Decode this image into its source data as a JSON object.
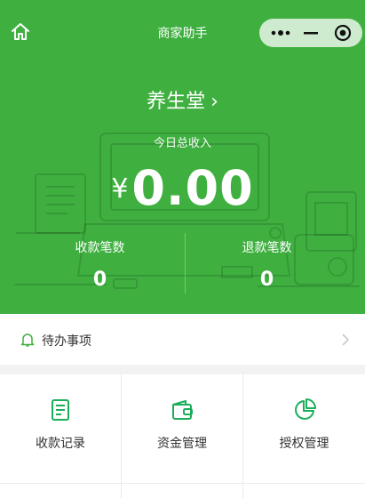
{
  "app": {
    "title": "商家助手"
  },
  "store": {
    "name": "养生堂",
    "chevron": "›"
  },
  "revenue": {
    "label": "今日总收入",
    "currency": "¥",
    "amount": "0.00"
  },
  "stats": [
    {
      "label": "收款笔数",
      "value": "0"
    },
    {
      "label": "退款笔数",
      "value": "0"
    }
  ],
  "todo": {
    "label": "待办事项"
  },
  "menu": [
    {
      "label": "收款记录",
      "icon": "receipt-icon"
    },
    {
      "label": "资金管理",
      "icon": "wallet-icon"
    },
    {
      "label": "授权管理",
      "icon": "pie-chart-icon"
    }
  ],
  "colors": {
    "brand_green": "#3fb040",
    "icon_green": "#1aad5a"
  }
}
